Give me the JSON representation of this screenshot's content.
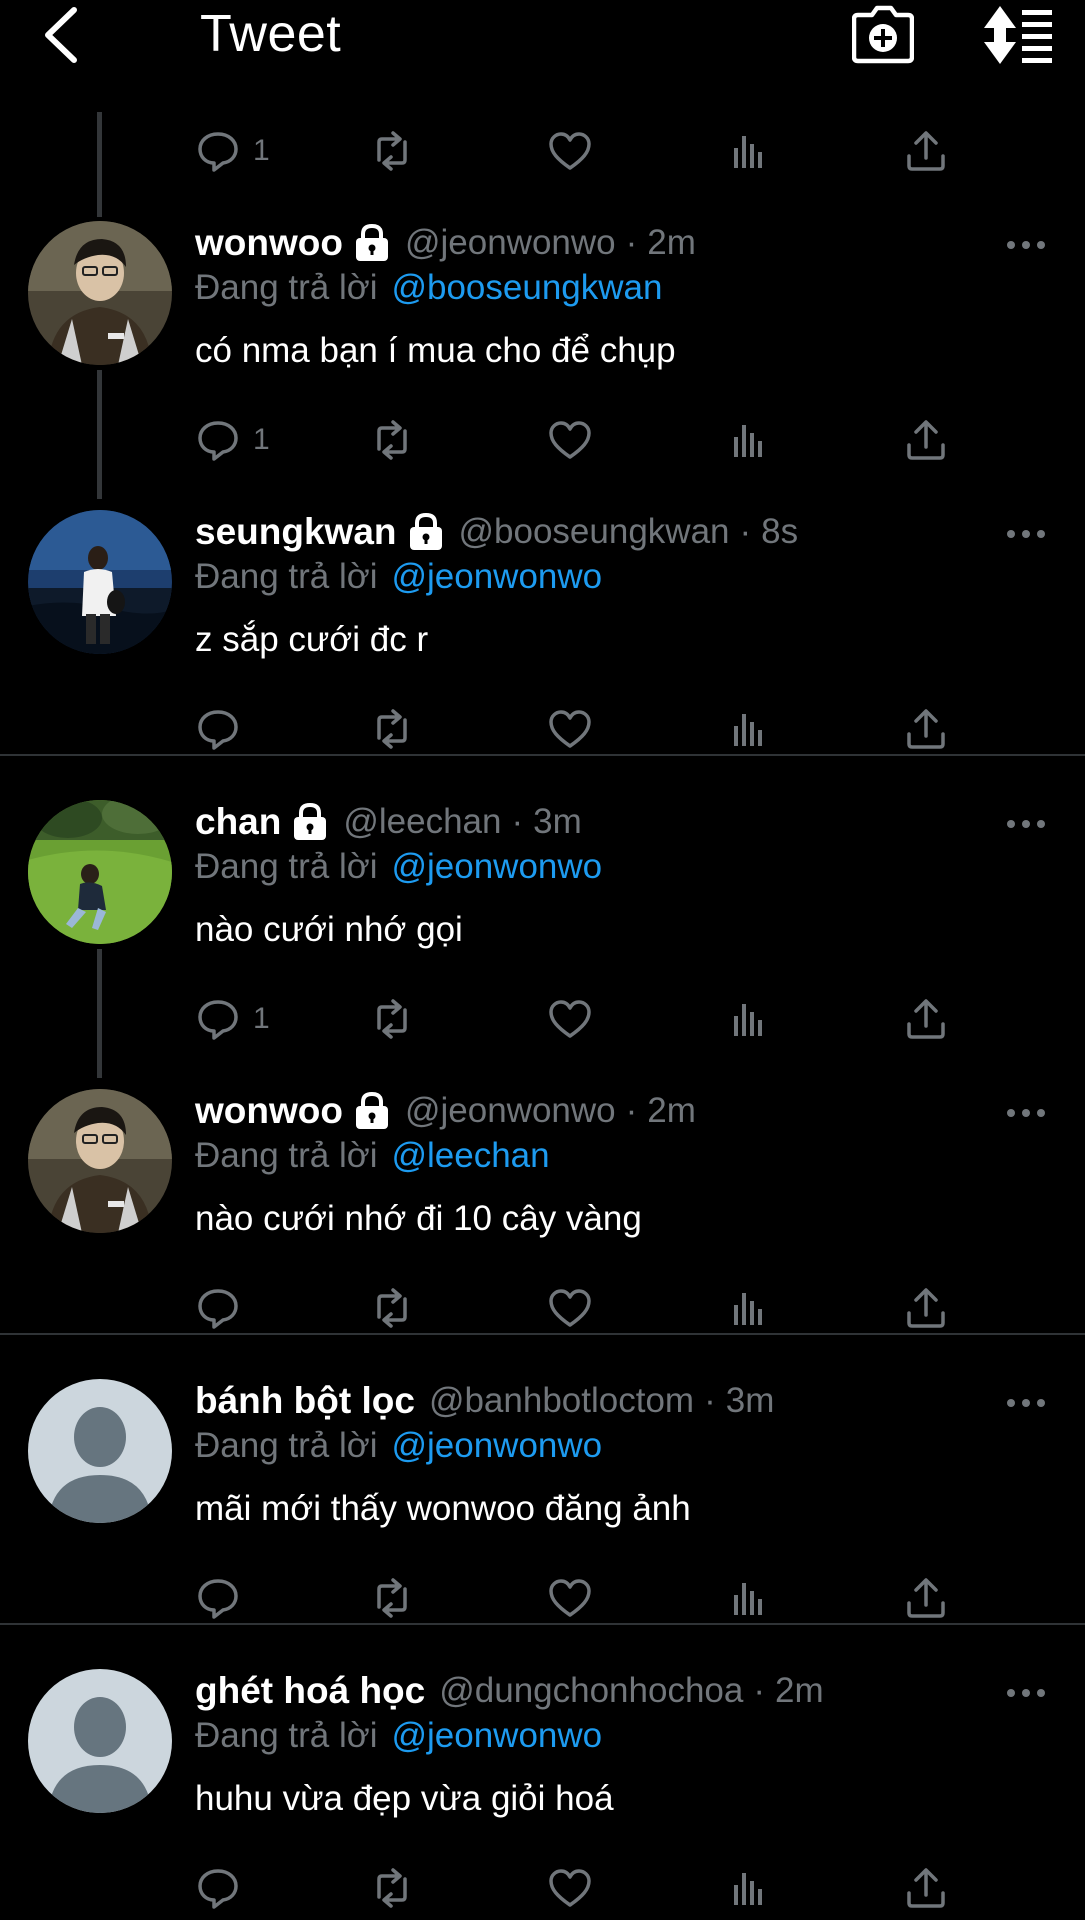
{
  "header": {
    "title": "Tweet",
    "back_icon": "chevron-left-icon",
    "camera_icon": "camera-plus-icon",
    "sort_icon": "sort-list-icon"
  },
  "colors": {
    "background": "#000000",
    "text": "#ffffff",
    "muted": "#71767b",
    "link": "#1d9bf0",
    "thread_line": "#333639",
    "divider": "#2f3336"
  },
  "top_actions": {
    "reply_count": "1"
  },
  "tweets": [
    {
      "name": "wonwoo",
      "handle": "@jeonwonwo",
      "separator": "·",
      "time": "2m",
      "locked": true,
      "reply_prefix": "Đang trả lời",
      "reply_to": "@booseungkwan",
      "text": "có nma bạn í mua cho để chụp",
      "reply_count": "1",
      "avatar": "photo-portrait"
    },
    {
      "name": "seungkwan",
      "handle": "@booseungkwan",
      "separator": "·",
      "time": "8s",
      "locked": true,
      "reply_prefix": "Đang trả lời",
      "reply_to": "@jeonwonwo",
      "text": "z sắp cưới đc r",
      "reply_count": "",
      "avatar": "photo-beach"
    },
    {
      "name": "chan",
      "handle": "@leechan",
      "separator": "·",
      "time": "3m",
      "locked": true,
      "reply_prefix": "Đang trả lời",
      "reply_to": "@jeonwonwo",
      "text": "nào cưới nhớ gọi",
      "reply_count": "1",
      "avatar": "photo-grass"
    },
    {
      "name": "wonwoo",
      "handle": "@jeonwonwo",
      "separator": "·",
      "time": "2m",
      "locked": true,
      "reply_prefix": "Đang trả lời",
      "reply_to": "@leechan",
      "text": "nào cưới nhớ đi 10 cây vàng",
      "reply_count": "",
      "avatar": "photo-portrait"
    },
    {
      "name": "bánh bột lọc",
      "handle": "@banhbotloctom",
      "separator": "·",
      "time": "3m",
      "locked": false,
      "reply_prefix": "Đang trả lời",
      "reply_to": "@jeonwonwo",
      "text": "mãi mới thấy wonwoo đăng ảnh",
      "reply_count": "",
      "avatar": "default-avatar"
    },
    {
      "name": "ghét hoá học",
      "handle": "@dungchonhochoa",
      "separator": "·",
      "time": "2m",
      "locked": false,
      "reply_prefix": "Đang trả lời",
      "reply_to": "@jeonwonwo",
      "text": "huhu vừa đẹp vừa giỏi hoá",
      "reply_count": "",
      "avatar": "default-avatar"
    }
  ]
}
